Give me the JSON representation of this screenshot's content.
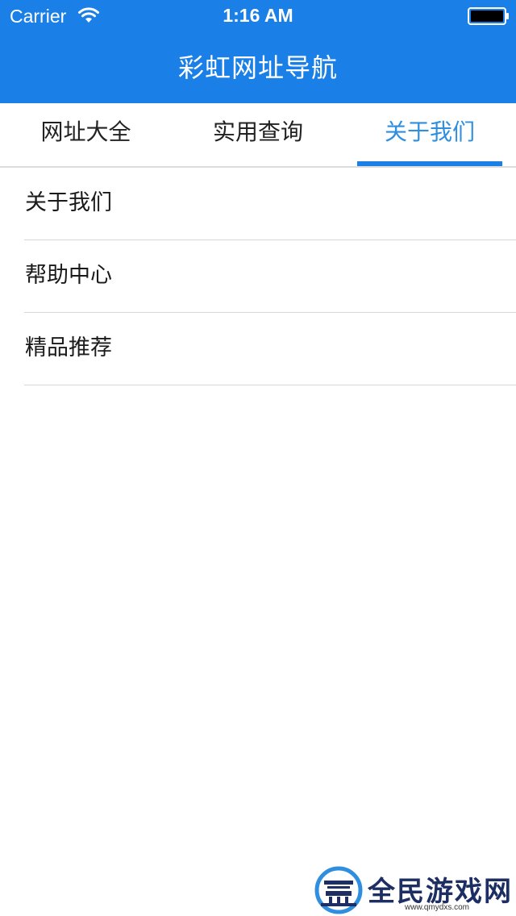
{
  "status_bar": {
    "carrier": "Carrier",
    "time": "1:16 AM"
  },
  "header": {
    "title": "彩虹网址导航",
    "background_color": "#1a7fe6"
  },
  "tabs": [
    {
      "label": "网址大全",
      "selected": false
    },
    {
      "label": "实用查询",
      "selected": false
    },
    {
      "label": "关于我们",
      "selected": true
    }
  ],
  "accent_color": "#2f8fde",
  "list": {
    "items": [
      {
        "label": "关于我们"
      },
      {
        "label": "帮助中心"
      },
      {
        "label": "精品推荐"
      }
    ]
  },
  "watermark": {
    "text": "全民游戏网",
    "url": "www.qmydxs.com"
  },
  "icons": {
    "wifi": "wifi-icon",
    "battery": "battery-icon"
  }
}
